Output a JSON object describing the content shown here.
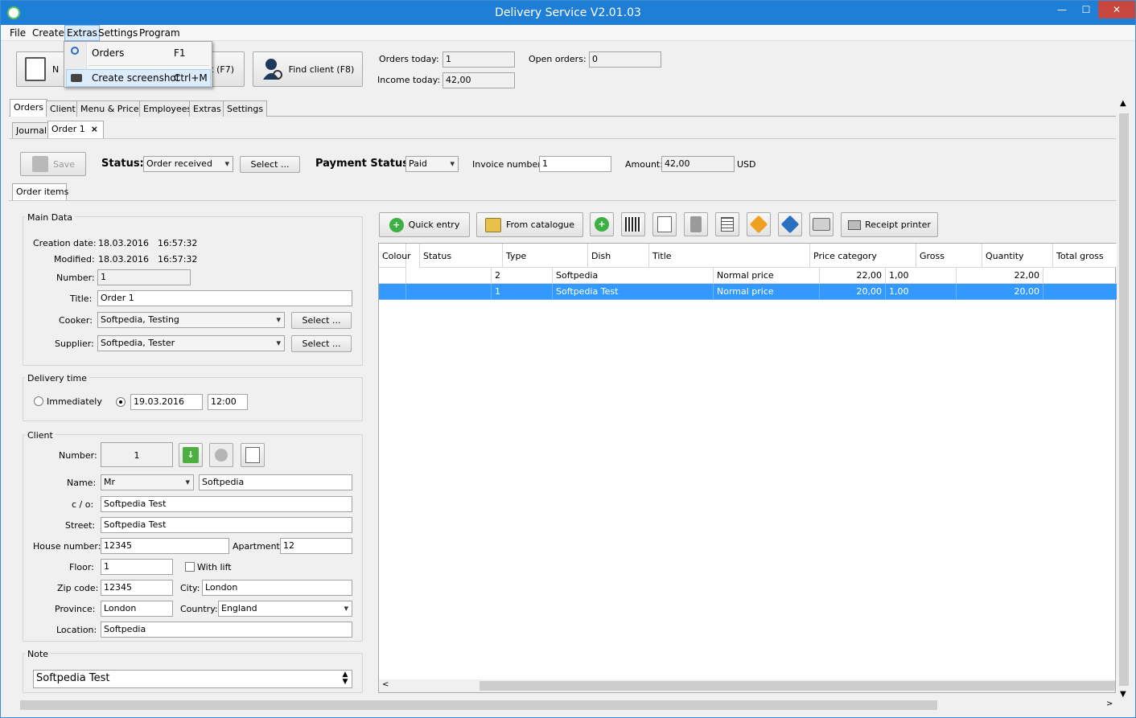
{
  "window": {
    "title": "Delivery Service V2.01.03",
    "minimize": "—",
    "maximize": "☐",
    "close": "✕"
  },
  "menu": [
    "File",
    "Create",
    "Extras",
    "Settings",
    "Program"
  ],
  "dropdown": {
    "items": [
      {
        "label": "Orders",
        "shortcut": "F1",
        "icon": "magnifier-icon"
      },
      {
        "label": "Create screenshot",
        "shortcut": "Ctrl+M",
        "icon": "camera-icon"
      }
    ]
  },
  "toolbar": {
    "new_order_label": "N",
    "hidden_label": "t (F7)",
    "find_client_label": "Find client (F8)"
  },
  "stats": {
    "orders_today_label": "Orders today:",
    "orders_today": "1",
    "open_orders_label": "Open orders:",
    "open_orders": "0",
    "income_today_label": "Income today:",
    "income_today": "42,00"
  },
  "main_tabs": [
    "Orders",
    "Client",
    "Menu & Prices",
    "Employees",
    "Extras",
    "Settings"
  ],
  "sub_tabs": [
    "Journal",
    "Order 1"
  ],
  "sub_tab_close": "×",
  "order_bar": {
    "save": "Save",
    "status_label": "Status:",
    "status_value": "Order received",
    "select": "Select ...",
    "payment_label": "Payment Status:",
    "payment_value": "Paid",
    "invoice_label": "Invoice number:",
    "invoice_value": "1",
    "amount_label": "Amount:",
    "amount_value": "42,00",
    "currency": "USD"
  },
  "order_items_tab": "Order items",
  "main_data": {
    "title": "Main Data",
    "creation_label": "Creation date:",
    "creation_date": "18.03.2016",
    "creation_time": "16:57:32",
    "modified_label": "Modified:",
    "modified_date": "18.03.2016",
    "modified_time": "16:57:32",
    "number_label": "Number:",
    "number": "1",
    "title_label": "Title:",
    "title_value": "Order 1",
    "cooker_label": "Cooker:",
    "cooker": "Softpedia, Testing",
    "supplier_label": "Supplier:",
    "supplier": "Softpedia, Tester",
    "select": "Select ..."
  },
  "delivery": {
    "title": "Delivery time",
    "immediately": "Immediately",
    "date": "19.03.2016",
    "time": "12:00"
  },
  "client": {
    "title": "Client",
    "number_label": "Number:",
    "number": "1",
    "name_label": "Name:",
    "salutation": "Mr",
    "name": "Softpedia",
    "co_label": "c / o:",
    "co": "Softpedia Test",
    "street_label": "Street:",
    "street": "Softpedia Test",
    "house_label": "House number:",
    "house": "12345",
    "apartment_label": "Apartment:",
    "apartment": "12",
    "floor_label": "Floor:",
    "floor": "1",
    "lift_label": "With lift",
    "zip_label": "Zip code:",
    "zip": "12345",
    "city_label": "City:",
    "city": "London",
    "province_label": "Province:",
    "province": "London",
    "country_label": "Country:",
    "country": "England",
    "location_label": "Location:",
    "location": "Softpedia"
  },
  "note": {
    "title": "Note",
    "value": "Softpedia Test"
  },
  "items_toolbar": {
    "quick_entry": "Quick entry",
    "from_catalogue": "From catalogue",
    "receipt_printer": "Receipt printer"
  },
  "table": {
    "headers": [
      "Colour",
      "Status",
      "Type",
      "Dish",
      "Title",
      "Price category",
      "Gross",
      "Quantity",
      "Total gross"
    ],
    "rows": [
      {
        "dish": "2",
        "title": "Softpedia",
        "price_category": "Normal price",
        "gross": "22,00",
        "quantity": "1,00",
        "total_gross": "22,00"
      },
      {
        "dish": "1",
        "title": "Softpedia Test",
        "price_category": "Normal price",
        "gross": "20,00",
        "quantity": "1,00",
        "total_gross": "20,00"
      }
    ]
  },
  "colors": {
    "titlebar": "#1f7fd6",
    "selection": "#3399ff",
    "green": "#3cb043"
  }
}
